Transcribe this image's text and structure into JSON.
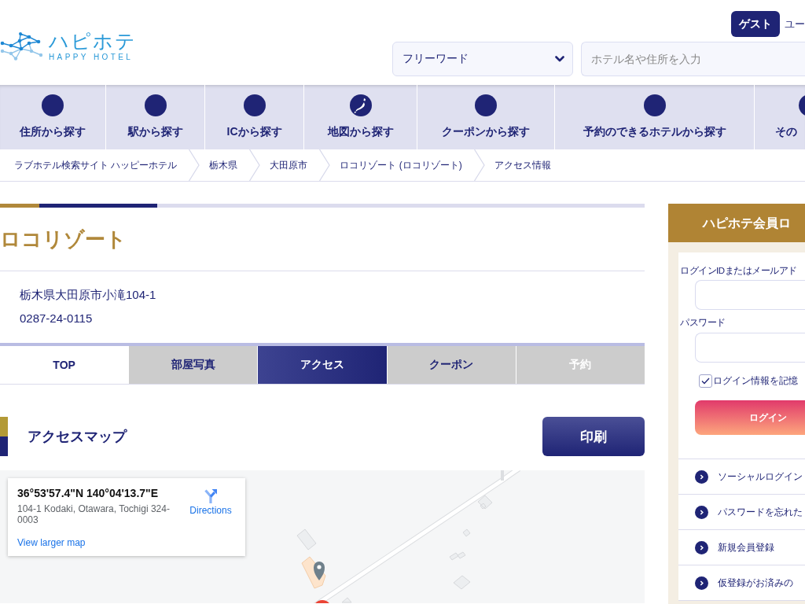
{
  "header": {
    "logo": {
      "name": "ハピホテ",
      "tagline": "HAPPY HOTEL"
    },
    "guest_badge": "ゲスト",
    "user_link": "ユー",
    "search": {
      "scope": "フリーワード",
      "placeholder": "ホテル名や住所を入力"
    }
  },
  "nav": [
    {
      "label": "住所から探す",
      "kind": "plain"
    },
    {
      "label": "駅から探す",
      "kind": "plain"
    },
    {
      "label": "ICから探す",
      "kind": "plain"
    },
    {
      "label": "地図から探す",
      "kind": "map"
    },
    {
      "label": "クーポンから探す",
      "kind": "plain"
    },
    {
      "label": "予約のできるホテルから探す",
      "kind": "plain"
    },
    {
      "label": "その",
      "kind": "plain"
    }
  ],
  "breadcrumb": [
    "ラブホテル検索サイト ハッピーホテル",
    "栃木県",
    "大田原市",
    "ロコリゾート (ロコリゾート)",
    "アクセス情報"
  ],
  "hotel": {
    "name": "ロコリゾート",
    "address": "栃木県大田原市小滝104-1",
    "phone": "0287-24-0115"
  },
  "tabs": [
    {
      "label": "TOP",
      "kind": "home",
      "selected": false,
      "disabled": false
    },
    {
      "label": "部屋写真",
      "kind": "page",
      "selected": false,
      "disabled": false
    },
    {
      "label": "アクセス",
      "kind": "page",
      "selected": true,
      "disabled": false
    },
    {
      "label": "クーポン",
      "kind": "page",
      "selected": false,
      "disabled": false
    },
    {
      "label": "予約",
      "kind": "page",
      "selected": false,
      "disabled": true
    }
  ],
  "access": {
    "title": "アクセスマップ",
    "print_button": "印刷",
    "map": {
      "coordinates": "36°53'57.4\"N 140°04'13.7\"E",
      "address": "104-1 Kodaki, Otawara, Tochigi 324-0003",
      "directions": "Directions",
      "larger_map_link": "View larger map"
    }
  },
  "login": {
    "title": "ハピホテ会員ロ",
    "id_label": "ログインIDまたはメールアド",
    "password_label": "パスワード",
    "remember": {
      "label": "ログイン情報を記憶",
      "checked": true
    },
    "submit": "ログイン",
    "links": [
      "ソーシャルログイン",
      "パスワードを忘れた",
      "新規会員登録",
      "仮登録がお済みの"
    ]
  }
}
